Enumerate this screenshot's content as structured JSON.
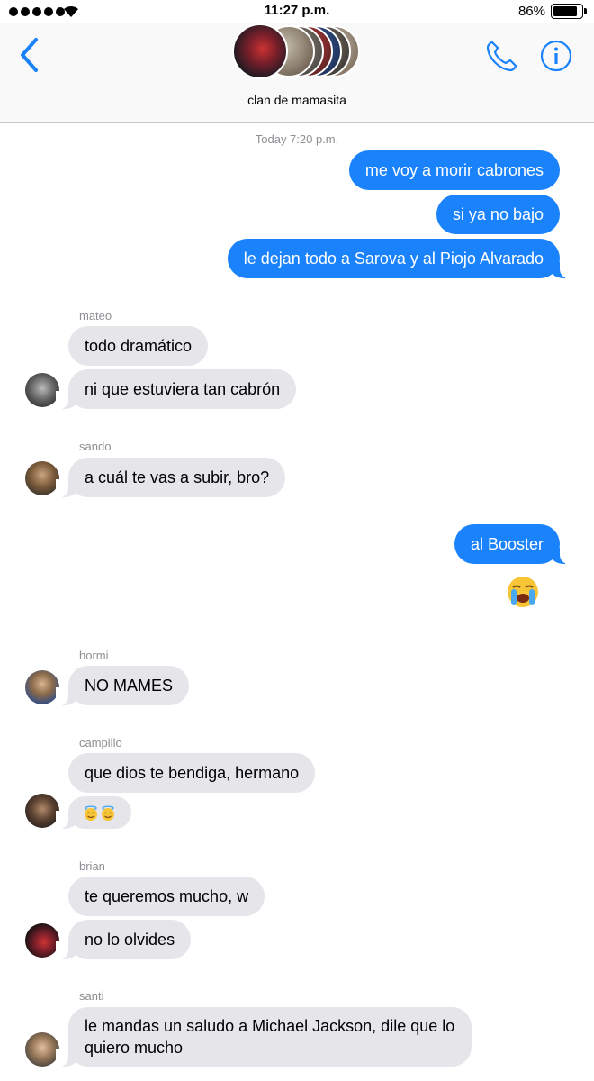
{
  "status_bar": {
    "time": "11:27 p.m.",
    "battery_percent": "86%",
    "battery_level": 0.86,
    "signal_bars": 5
  },
  "header": {
    "group_name": "clan de mamasita",
    "back_icon": "chevron-left-icon",
    "call_icon": "phone-icon",
    "info_icon": "info-icon"
  },
  "conversation": {
    "timestamp": "Today 7:20 p.m.",
    "sent_1": [
      "me voy a morir cabrones",
      "si ya no bajo",
      "le dejan todo a Sarova y al Piojo Alvarado"
    ],
    "mateo": {
      "name": "mateo",
      "messages": [
        "todo dramático",
        "ni que estuviera tan cabrón"
      ]
    },
    "sando": {
      "name": "sando",
      "messages": [
        "a cuál te vas a subir, bro?"
      ]
    },
    "sent_2": [
      "al Booster"
    ],
    "sent_emoji": "loudly-crying-face-emoji",
    "hormi": {
      "name": "hormi",
      "messages": [
        "NO MAMES"
      ]
    },
    "campillo": {
      "name": "campillo",
      "messages": [
        "que dios te bendiga, hermano"
      ],
      "emoji": "smiling-face-with-halo-emoji x2"
    },
    "brian": {
      "name": "brian",
      "messages": [
        "te queremos mucho, w",
        "no lo olvides"
      ]
    },
    "santi": {
      "name": "santi",
      "messages": [
        "le mandas un saludo a Michael Jackson, dile que lo quiero mucho"
      ]
    }
  },
  "colors": {
    "sent_bubble": "#1a82fb",
    "received_bubble": "#e5e5ea",
    "accent": "#1a82fb",
    "secondary_text": "#8e8e93"
  }
}
